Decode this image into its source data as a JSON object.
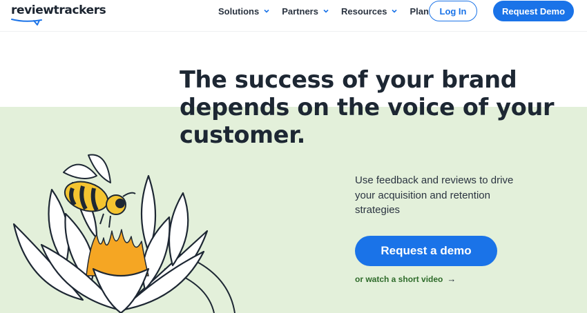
{
  "header": {
    "logo_text": "reviewtrackers",
    "nav": [
      {
        "label": "Solutions",
        "has_dropdown": true
      },
      {
        "label": "Partners",
        "has_dropdown": true
      },
      {
        "label": "Resources",
        "has_dropdown": true
      },
      {
        "label": "Plans",
        "has_dropdown": false
      }
    ],
    "login_label": "Log In",
    "demo_label": "Request Demo"
  },
  "hero": {
    "headline": "The success of your brand depends on the voice of your customer.",
    "subtext": "Use feedback and reviews to drive your acquisition and retention strategies",
    "cta_label": "Request a demo",
    "video_link": "or watch a short video",
    "video_arrow": "→"
  },
  "colors": {
    "accent": "#1a73e8",
    "green_band": "#e3f0da",
    "headline": "#1d2733",
    "link_green": "#2e6b2a",
    "flower_orange": "#f5a623",
    "bee_yellow": "#f4c430"
  }
}
